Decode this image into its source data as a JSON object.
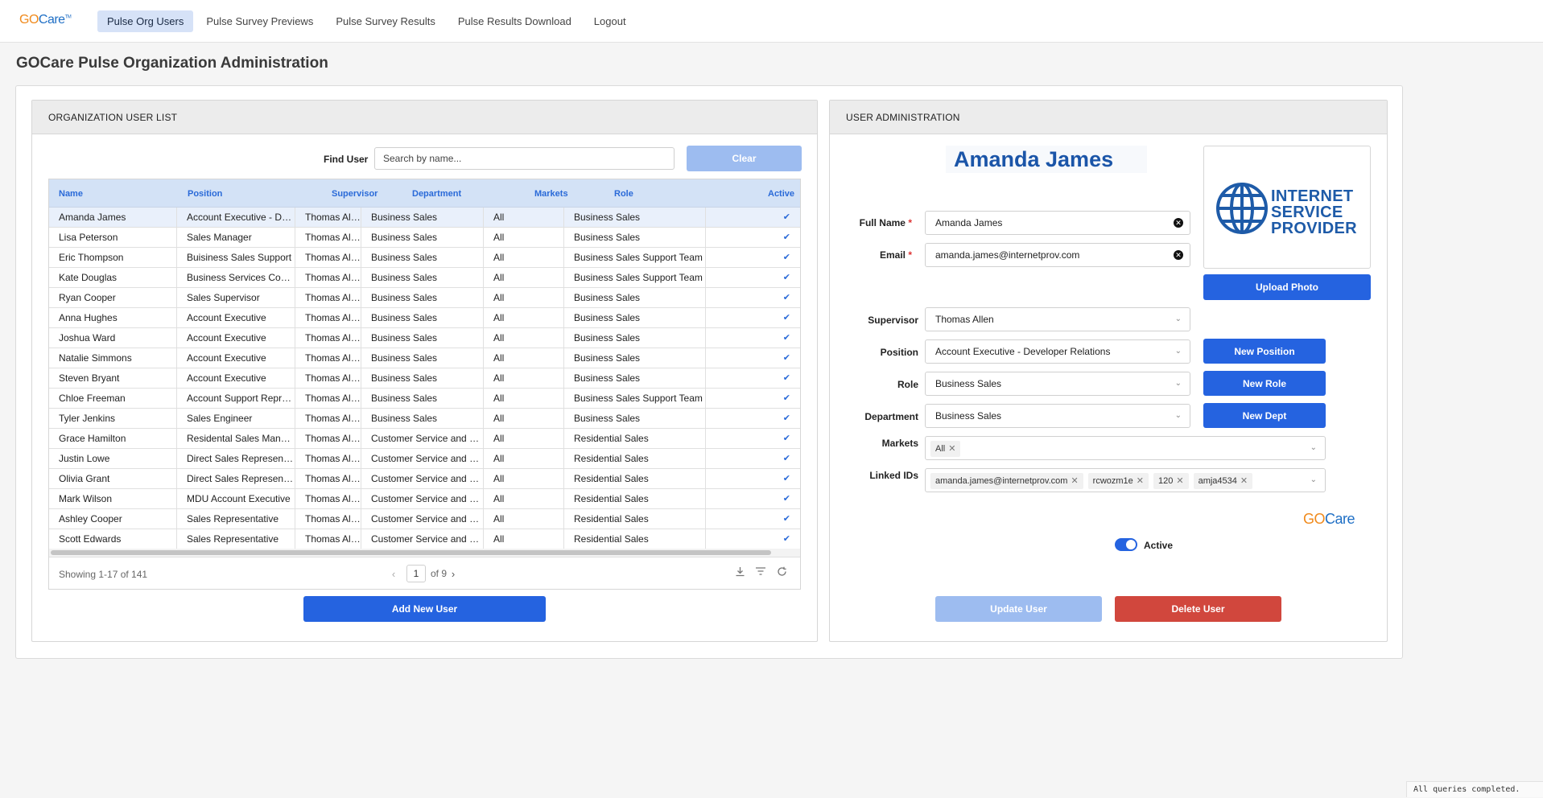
{
  "nav": {
    "logo_go": "GO",
    "logo_care": "Care",
    "logo_tm": "TM",
    "links": [
      "Pulse Org Users",
      "Pulse Survey Previews",
      "Pulse Survey Results",
      "Pulse Results Download",
      "Logout"
    ],
    "active_index": 0
  },
  "page_title": "GOCare Pulse Organization Administration",
  "user_list": {
    "header": "ORGANIZATION USER LIST",
    "find_label": "Find User",
    "search_placeholder": "Search by name...",
    "clear_label": "Clear",
    "columns": [
      "Name",
      "Position",
      "Supervisor",
      "Department",
      "Markets",
      "Role",
      "Active"
    ],
    "rows": [
      [
        "Amanda James",
        "Account Executive - Developer Relations",
        "Thomas Allen",
        "Business Sales",
        "All",
        "Business Sales",
        "✔"
      ],
      [
        "Lisa Peterson",
        "Sales Manager",
        "Thomas Allen",
        "Business Sales",
        "All",
        "Business Sales",
        "✔"
      ],
      [
        "Eric Thompson",
        "Buisiness Sales Support",
        "Thomas Allen",
        "Business Sales",
        "All",
        "Business Sales Support Team",
        "✔"
      ],
      [
        "Kate Douglas",
        "Business Services Coordinator",
        "Thomas Allen",
        "Business Sales",
        "All",
        "Business Sales Support Team",
        "✔"
      ],
      [
        "Ryan Cooper",
        "Sales Supervisor",
        "Thomas Allen",
        "Business Sales",
        "All",
        "Business Sales",
        "✔"
      ],
      [
        "Anna Hughes",
        "Account Executive",
        "Thomas Allen",
        "Business Sales",
        "All",
        "Business Sales",
        "✔"
      ],
      [
        "Joshua Ward",
        "Account Executive",
        "Thomas Allen",
        "Business Sales",
        "All",
        "Business Sales",
        "✔"
      ],
      [
        "Natalie Simmons",
        "Account Executive",
        "Thomas Allen",
        "Business Sales",
        "All",
        "Business Sales",
        "✔"
      ],
      [
        "Steven Bryant",
        "Account Executive",
        "Thomas Allen",
        "Business Sales",
        "All",
        "Business Sales",
        "✔"
      ],
      [
        "Chloe Freeman",
        "Account Support Representative",
        "Thomas Allen",
        "Business Sales",
        "All",
        "Business Sales Support Team",
        "✔"
      ],
      [
        "Tyler Jenkins",
        "Sales Engineer",
        "Thomas Allen",
        "Business Sales",
        "All",
        "Business Sales",
        "✔"
      ],
      [
        "Grace Hamilton",
        "Residental Sales Manager",
        "Thomas Allen",
        "Customer Service and Sales",
        "All",
        "Residential Sales",
        "✔"
      ],
      [
        "Justin Lowe",
        "Direct Sales Representative",
        "Thomas Allen",
        "Customer Service and Sales",
        "All",
        "Residential Sales",
        "✔"
      ],
      [
        "Olivia Grant",
        "Direct Sales Representative",
        "Thomas Allen",
        "Customer Service and Sales",
        "All",
        "Residential Sales",
        "✔"
      ],
      [
        "Mark Wilson",
        "MDU Account Executive",
        "Thomas Allen",
        "Customer Service and Sales",
        "All",
        "Residential Sales",
        "✔"
      ],
      [
        "Ashley Cooper",
        "Sales Representative",
        "Thomas Allen",
        "Customer Service and Sales",
        "All",
        "Residential Sales",
        "✔"
      ],
      [
        "Scott Edwards",
        "Sales Representative",
        "Thomas Allen",
        "Customer Service and Sales",
        "All",
        "Residential Sales",
        "✔"
      ]
    ],
    "selected_row": 0,
    "showing": "Showing 1-17 of 141",
    "page": "1",
    "of_pages": "of 9",
    "add_label": "Add New User"
  },
  "user_admin": {
    "header": "USER ADMINISTRATION",
    "display_name": "Amanda James",
    "photo_logo_text": [
      "INTERNET",
      "SERVICE",
      "PROVIDER"
    ],
    "upload_label": "Upload Photo",
    "full_name_label": "Full Name",
    "full_name": "Amanda James",
    "email_label": "Email",
    "email": "amanda.james@internetprov.com",
    "required_mark": "*",
    "supervisor_label": "Supervisor",
    "supervisor": "Thomas Allen",
    "position_label": "Position",
    "position": "Account Executive - Developer Relations",
    "role_label": "Role",
    "role": "Business Sales",
    "department_label": "Department",
    "department": "Business Sales",
    "markets_label": "Markets",
    "markets": [
      "All"
    ],
    "linked_ids_label": "Linked IDs",
    "linked_ids": [
      "amanda.james@internetprov.com",
      "rcwozm1e",
      "120",
      "amja4534"
    ],
    "new_position_label": "New Position",
    "new_role_label": "New Role",
    "new_dept_label": "New Dept",
    "active_label": "Active",
    "active": true,
    "update_label": "Update User",
    "delete_label": "Delete User"
  },
  "status_text": "All queries completed.",
  "colors": {
    "primary": "#2563e0",
    "primary_disabled": "#9dbcf0",
    "danger": "#d1473d",
    "header_link": "#2a6ad8"
  },
  "icons": {
    "clear_field": "x-circle-icon",
    "dropdown": "chevron-down-icon",
    "check": "checkmark-icon",
    "download": "download-icon",
    "filter": "filter-icon",
    "refresh": "refresh-icon"
  }
}
